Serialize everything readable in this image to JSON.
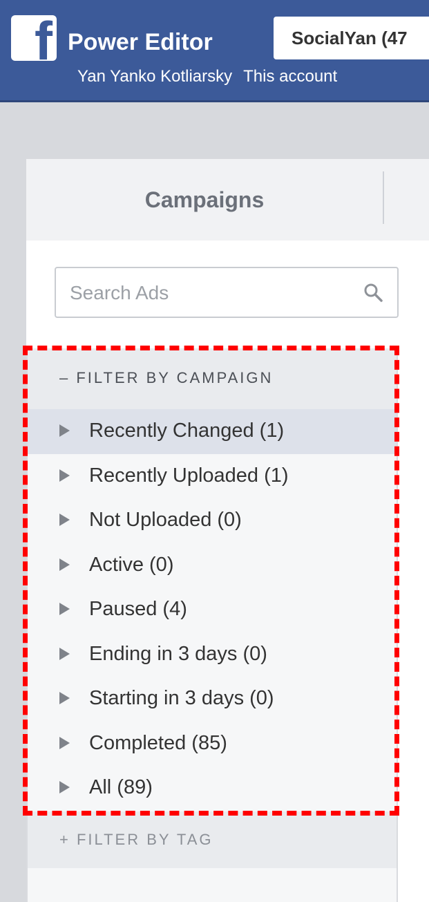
{
  "header": {
    "logo_letter": "f",
    "app_title": "Power Editor",
    "user_name": "Yan Yanko Kotliarsky",
    "account_link": "This account",
    "account_selector": "SocialYan (47"
  },
  "tabs": {
    "campaigns": "Campaigns"
  },
  "search": {
    "placeholder": "Search Ads",
    "value": ""
  },
  "filters": {
    "campaign_header": "– FILTER BY CAMPAIGN",
    "items": [
      {
        "label": "Recently Changed (1)"
      },
      {
        "label": "Recently Uploaded (1)"
      },
      {
        "label": "Not Uploaded (0)"
      },
      {
        "label": "Active (0)"
      },
      {
        "label": "Paused (4)"
      },
      {
        "label": "Ending in 3 days (0)"
      },
      {
        "label": "Starting in 3 days (0)"
      },
      {
        "label": "Completed (85)"
      },
      {
        "label": "All (89)"
      }
    ],
    "selected_index": 0,
    "tag_header": "+ FILTER BY TAG"
  },
  "colors": {
    "header_bg": "#3c5a99",
    "highlight": "#ff0000",
    "selected_row": "#dde1ea"
  }
}
